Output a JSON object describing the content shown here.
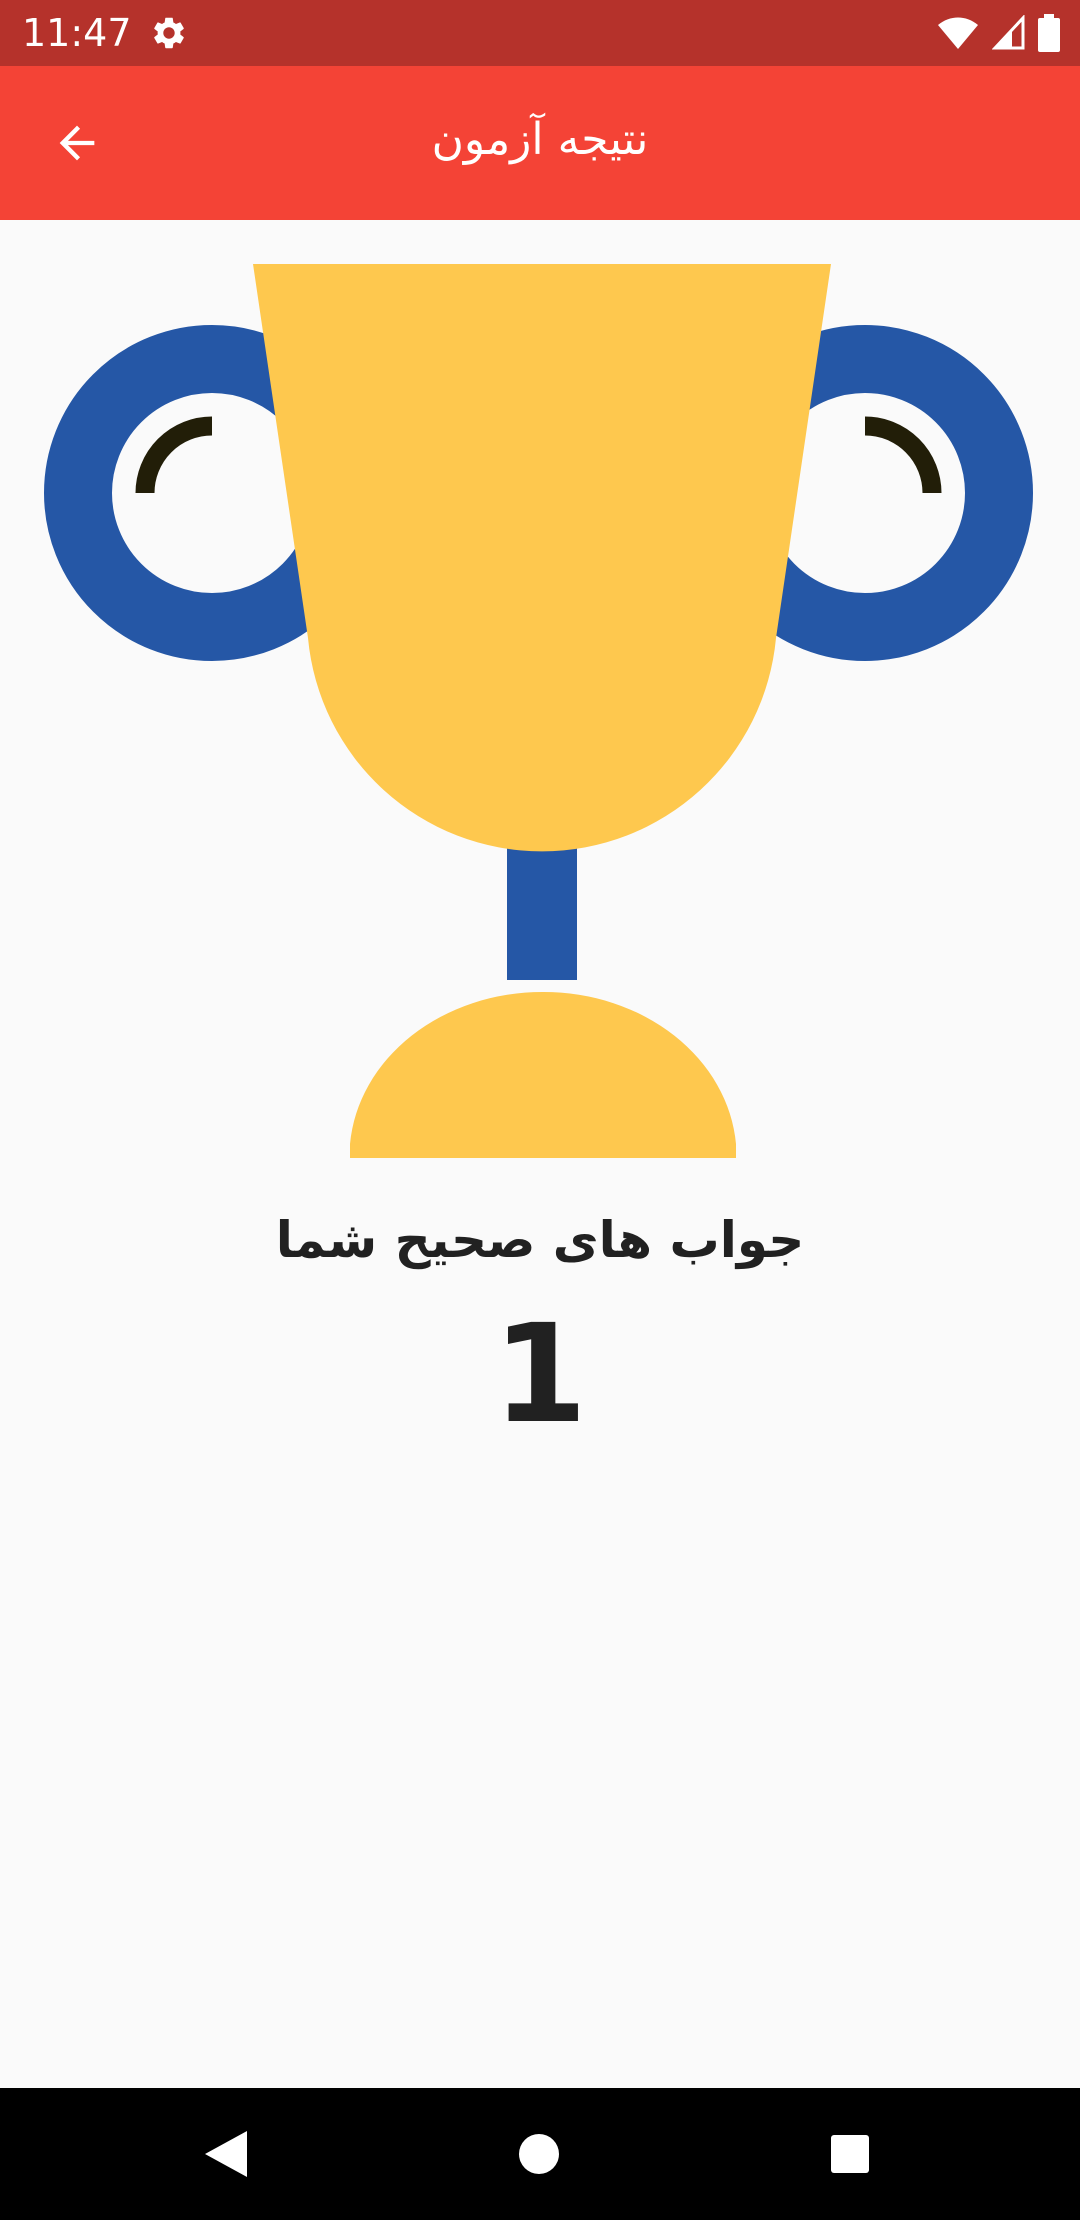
{
  "status_bar": {
    "time": "11:47",
    "icons": [
      "settings-gear-icon",
      "wifi-icon",
      "cellular-signal-icon",
      "battery-icon"
    ],
    "color": "#b5322b"
  },
  "app_bar": {
    "title": "نتیجه آزمون",
    "back_icon": "arrow-back-icon",
    "color": "#f44336"
  },
  "trophy": {
    "icon": "trophy-icon",
    "cup_color": "#fec84e",
    "handle_color": "#2557a6",
    "accent_color": "#221e08"
  },
  "result": {
    "label": "جواب های صحیح شما",
    "value": "1"
  },
  "nav_bar": {
    "buttons": [
      "back-triangle-icon",
      "home-circle-icon",
      "recents-square-icon"
    ]
  }
}
